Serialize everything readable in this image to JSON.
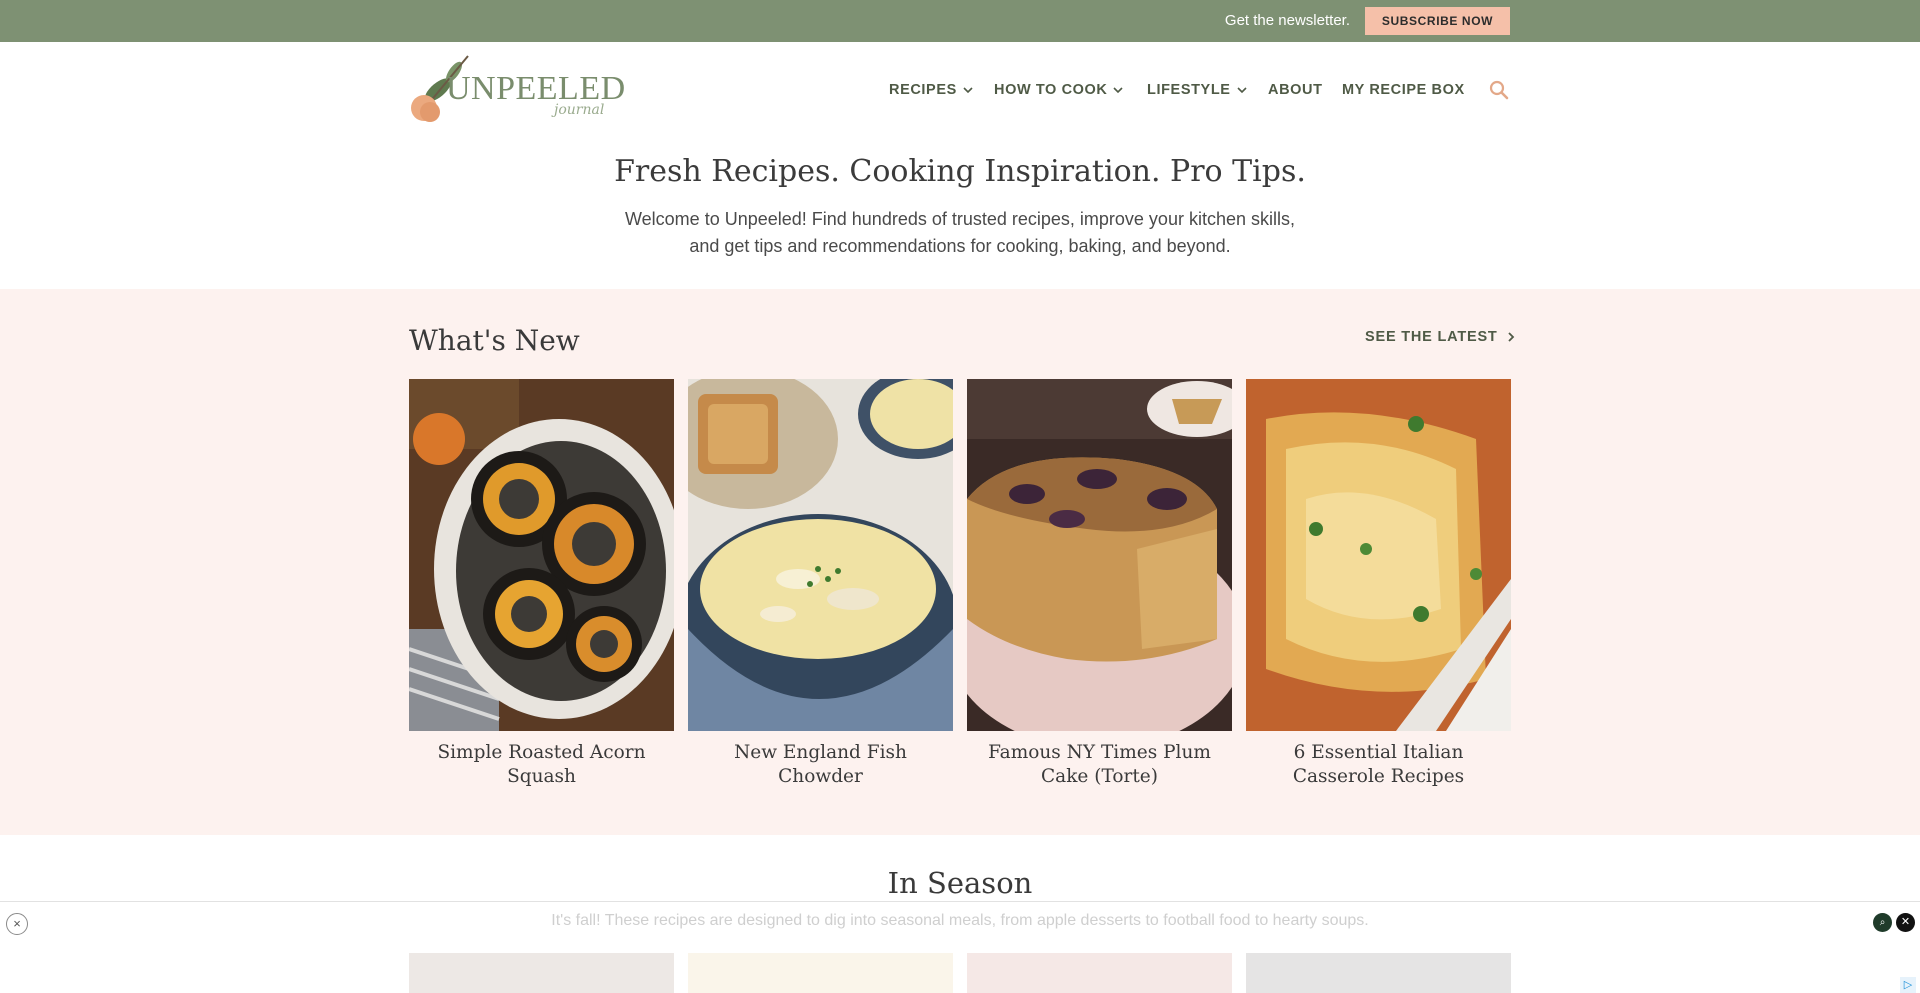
{
  "topbar": {
    "newsletter_text": "Get the newsletter.",
    "subscribe_label": "SUBSCRIBE NOW"
  },
  "header": {
    "logo_main": "UNPEELED",
    "logo_sub": "journal",
    "nav": [
      {
        "label": "RECIPES",
        "has_dropdown": true
      },
      {
        "label": "HOW TO COOK",
        "has_dropdown": true
      },
      {
        "label": "LIFESTYLE",
        "has_dropdown": true
      },
      {
        "label": "ABOUT",
        "has_dropdown": false
      },
      {
        "label": "MY RECIPE BOX",
        "has_dropdown": false
      }
    ],
    "search_icon": "search-icon"
  },
  "intro": {
    "tagline": "Fresh Recipes. Cooking Inspiration. Pro Tips.",
    "description": "Welcome to Unpeeled! Find hundreds of trusted recipes, improve your kitchen skills, and get tips and recommendations for cooking, baking, and beyond."
  },
  "whats_new": {
    "title": "What's New",
    "see_latest_label": "SEE THE LATEST",
    "cards": [
      {
        "title": "Simple Roasted Acorn Squash"
      },
      {
        "title": "New England Fish Chowder"
      },
      {
        "title": "Famous NY Times Plum Cake (Torte)"
      },
      {
        "title": "6 Essential Italian Casserole Recipes"
      }
    ]
  },
  "in_season": {
    "title": "In Season",
    "description": "It's fall! These recipes are designed to dig into seasonal meals, from apple desserts to football food to hearty soups."
  },
  "ad_overlay": {
    "close_glyph": "×",
    "info_glyph": "⌕",
    "dismiss_glyph": "✕",
    "play_glyph": "▷"
  },
  "colors": {
    "topbar_bg": "#7e9173",
    "subscribe_bg": "#f5c0a9",
    "section_bg": "#fdf2ef",
    "nav_text": "#4f5a46"
  }
}
